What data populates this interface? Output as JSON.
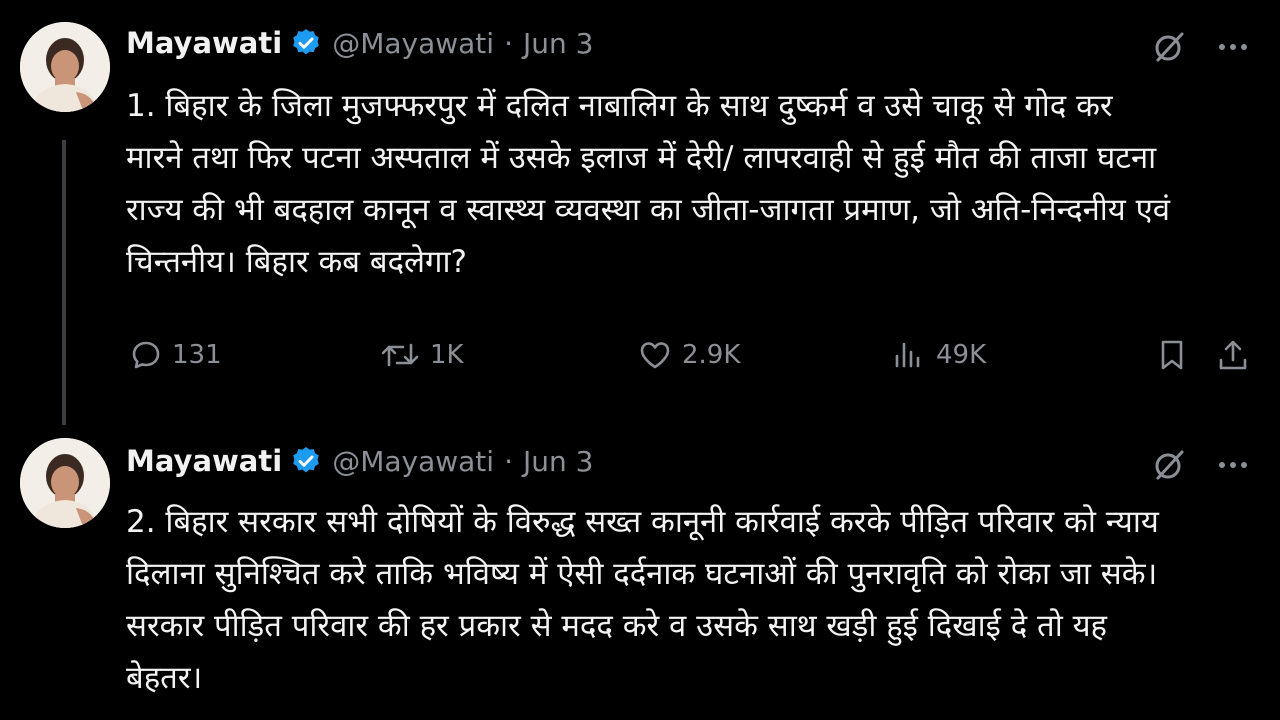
{
  "tweets": [
    {
      "author": {
        "name": "Mayawati",
        "handle": "@Mayawati",
        "date": "Jun 3"
      },
      "text": "1. बिहार के जिला मुजफ्फरपुर में दलित नाबालिग के साथ दुष्कर्म व उसे चाकू से गोद कर\nमारने तथा फिर पटना अस्पताल में उसके इलाज में देरी/ लापरवाही से हुई मौत की ताजा घटना\nराज्य की भी बदहाल कानून व स्वास्थ्य व्यवस्था का जीता-जागता प्रमाण, जो अति-निन्दनीय एवं\nचिन्तनीय। बिहार कब बदलेगा?",
      "metrics": {
        "replies": "131",
        "reposts": "1K",
        "likes": "2.9K",
        "views": "49K"
      }
    },
    {
      "author": {
        "name": "Mayawati",
        "handle": "@Mayawati",
        "date": "Jun 3"
      },
      "text": "2. बिहार सरकार सभी दोषियों के विरुद्ध सख्त कानूनी कार्रवाई करके पीड़ित परिवार को न्याय\nदिलाना सुनिश्चित करे ताकि भविष्य में ऐसी दर्दनाक घटनाओं की पुनरावृति को रोका जा सके।\nसरकार पीड़ित परिवार की हर प्रकार से मदद करे व उसके साथ खड़ी हुई दिखाई दे तो यह\nबेहतर।"
    }
  ],
  "separator": "·",
  "icons": {
    "verified": "verified-badge-icon",
    "grok": "grok-icon",
    "more": "more-icon",
    "reply": "reply-icon",
    "repost": "repost-icon",
    "like": "like-icon",
    "views": "views-icon",
    "bookmark": "bookmark-icon",
    "share": "share-icon"
  },
  "colors": {
    "background": "#000000",
    "text": "#e7e9ea",
    "muted": "#8b9096",
    "verified": "#1d9bf0"
  }
}
